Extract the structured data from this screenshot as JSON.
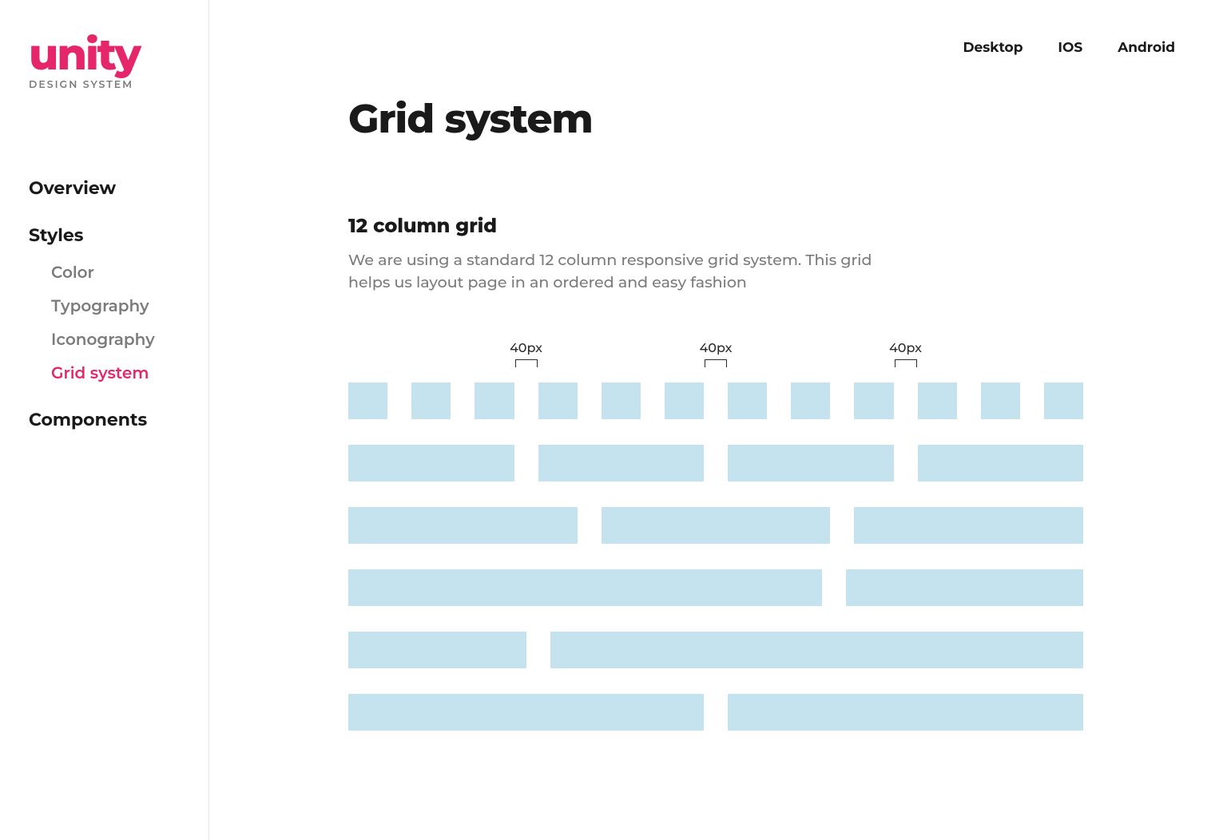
{
  "brand": {
    "name": "unity",
    "tagline": "DESIGN SYSTEM"
  },
  "sidebar": {
    "overview": "Overview",
    "styles": "Styles",
    "subitems": [
      "Color",
      "Typography",
      "Iconography",
      "Grid system"
    ],
    "components": "Components"
  },
  "topnav": [
    "Desktop",
    "IOS",
    "Android"
  ],
  "page": {
    "title": "Grid system",
    "section_title": "12 column grid",
    "section_desc": "We are using a standard 12 column responsive grid system. This grid helps us layout page in an ordered and easy fashion"
  },
  "grid": {
    "gutter_label": "40px",
    "rows": [
      [
        1,
        1,
        1,
        1,
        1,
        1,
        1,
        1,
        1,
        1,
        1,
        1
      ],
      [
        3,
        3,
        3,
        3
      ],
      [
        4,
        4,
        4
      ],
      [
        8,
        4
      ],
      [
        3,
        9
      ],
      [
        6,
        6
      ]
    ]
  }
}
